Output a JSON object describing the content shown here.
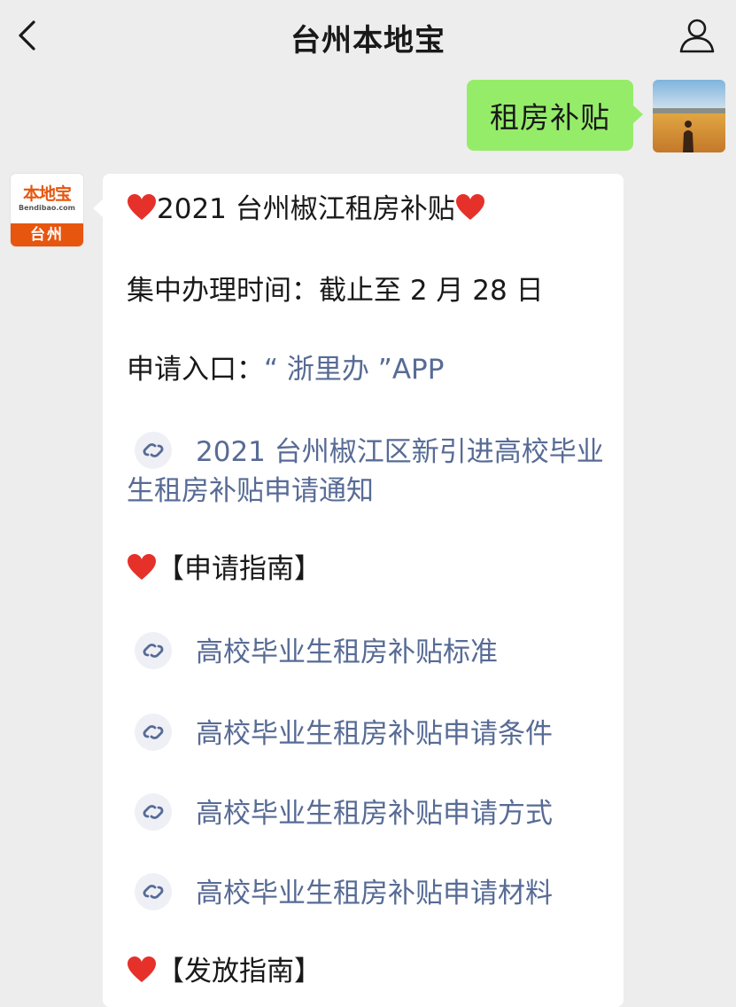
{
  "header": {
    "title": "台州本地宝",
    "back_icon": "chevron-left-icon",
    "profile_icon": "person-icon"
  },
  "outgoing": {
    "text": "租房补贴"
  },
  "bot": {
    "logo_text": "本地宝",
    "logo_sub": "Bendibao.com",
    "logo_city": "台州"
  },
  "message": {
    "title": "2021 台州椒江租房补贴",
    "deadline_label": "集中办理时间：",
    "deadline_value": "截止至 2 月 28 日",
    "entry_label": "申请入口：",
    "entry_value": "“ 浙里办 ”APP",
    "notice_link": "2021 台州椒江区新引进高校毕业生租房补贴申请通知",
    "section_apply": "【申请指南】",
    "links": [
      "高校毕业生租房补贴标准",
      "高校毕业生租房补贴申请条件",
      "高校毕业生租房补贴申请方式",
      "高校毕业生租房补贴申请材料"
    ],
    "section_release": "【发放指南】"
  },
  "colors": {
    "background": "#ededed",
    "outgoing_bubble": "#95ec69",
    "link": "#576b95",
    "heart": "#e5312a",
    "brand": "#e7560f"
  }
}
